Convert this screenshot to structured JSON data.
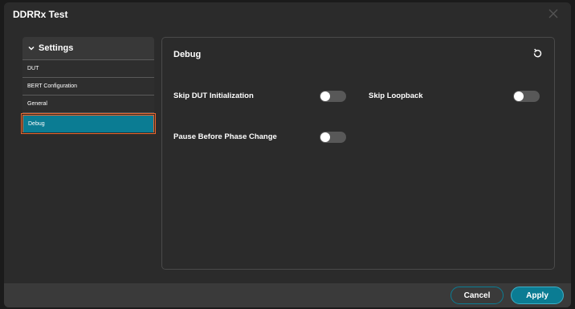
{
  "window": {
    "title": "DDRRx Test",
    "close_icon": "close-icon"
  },
  "sidebar": {
    "header_label": "Settings",
    "header_icon": "chevron-down-icon",
    "items": [
      {
        "label": "DUT",
        "active": false
      },
      {
        "label": "BERT Configuration",
        "active": false
      },
      {
        "label": "General",
        "active": false
      },
      {
        "label": "Debug",
        "active": true
      }
    ]
  },
  "panel": {
    "title": "Debug",
    "refresh_icon": "refresh-icon",
    "settings": [
      {
        "label": "Skip DUT Initialization",
        "enabled": false
      },
      {
        "label": "Skip Loopback",
        "enabled": false
      },
      {
        "label": "Pause Before Phase Change",
        "enabled": false
      }
    ]
  },
  "footer": {
    "cancel_label": "Cancel",
    "apply_label": "Apply"
  },
  "colors": {
    "accent": "#0b7c93",
    "highlight_border": "#e9652c"
  }
}
